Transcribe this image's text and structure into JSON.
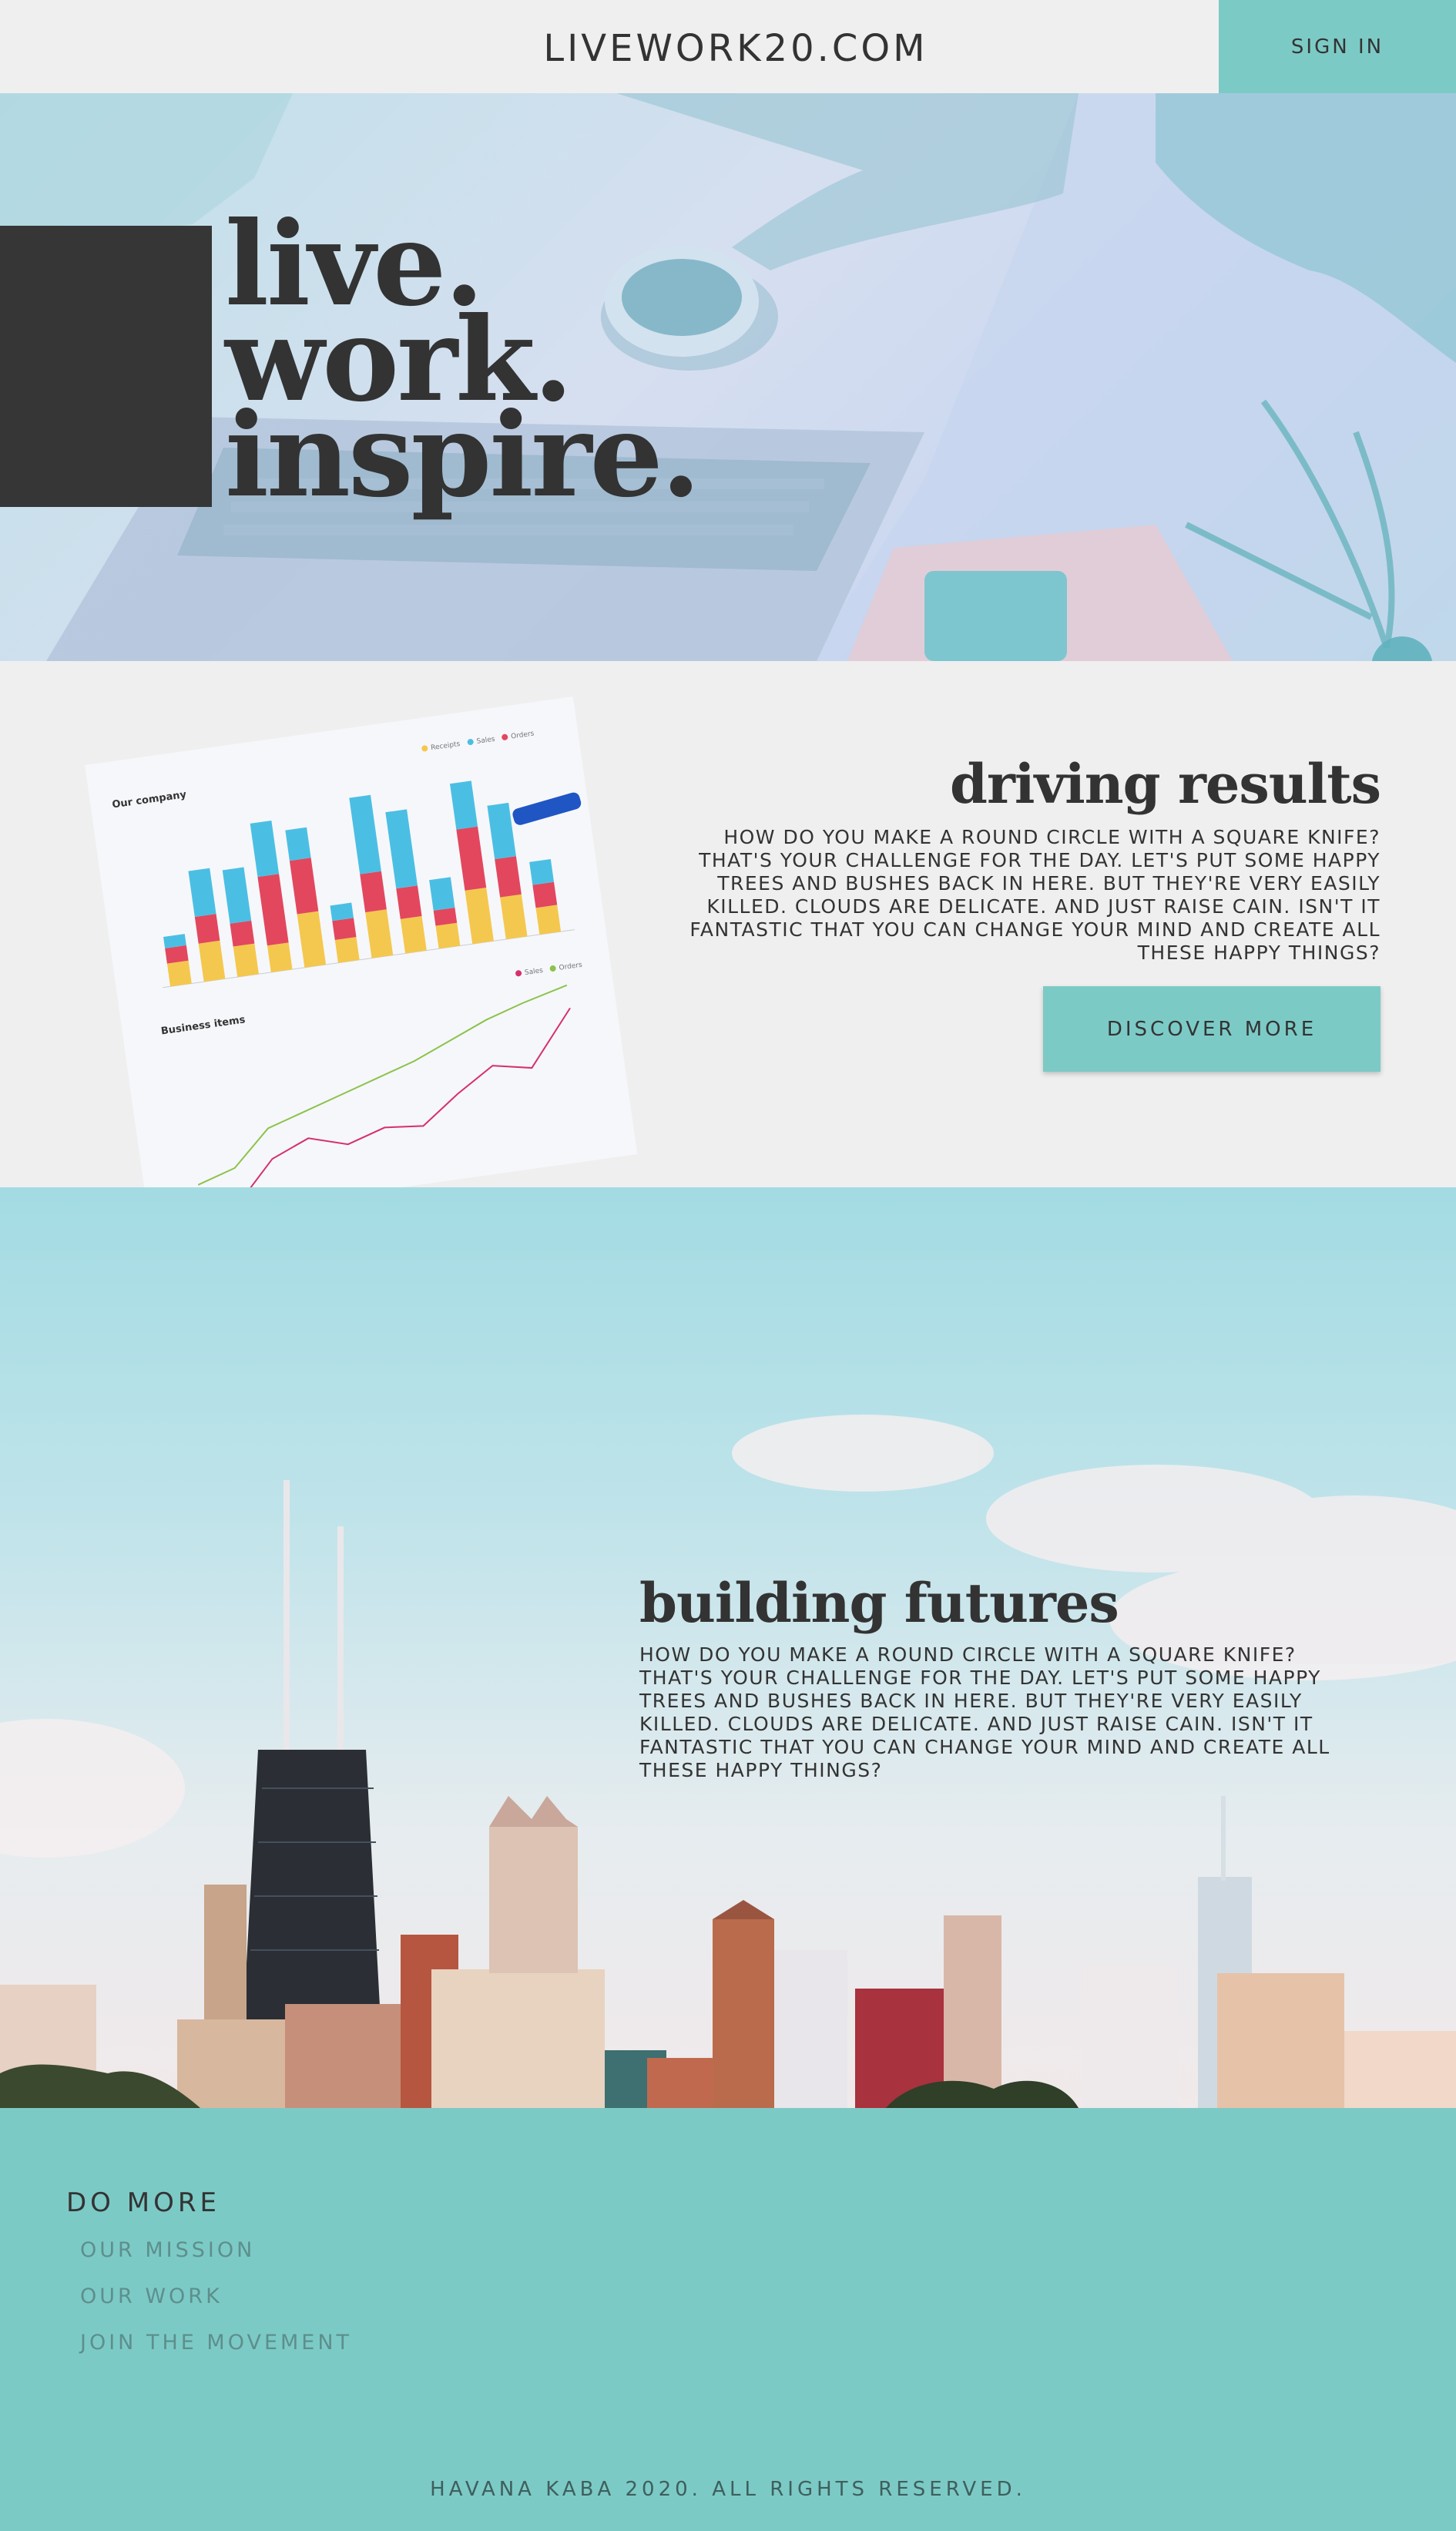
{
  "header": {
    "brand": "LIVEWORK20.COM",
    "signin_label": "SIGN IN"
  },
  "hero": {
    "line1": "live.",
    "line2": "work.",
    "line3": "inspire."
  },
  "results": {
    "title": "driving results",
    "body": "HOW DO YOU MAKE A ROUND CIRCLE WITH A SQUARE KNIFE? THAT'S YOUR CHALLENGE FOR THE DAY. LET'S PUT SOME HAPPY TREES AND BUSHES BACK IN HERE. BUT THEY'RE VERY EASILY KILLED. CLOUDS ARE DELICATE. AND JUST RAISE CAIN. ISN'T IT FANTASTIC THAT YOU CAN CHANGE YOUR MIND AND CREATE ALL THESE HAPPY THINGS?",
    "button_label": "DISCOVER MORE",
    "report": {
      "chart1_title": "Our company",
      "chart2_title": "Business items",
      "legend1": [
        "Receipts",
        "Sales",
        "Orders"
      ],
      "legend2": [
        "Sales",
        "Orders"
      ]
    }
  },
  "futures": {
    "title": "building futures",
    "body": "HOW DO YOU MAKE A ROUND CIRCLE WITH A SQUARE KNIFE? THAT'S YOUR CHALLENGE FOR THE DAY. LET'S PUT SOME HAPPY TREES AND BUSHES BACK IN HERE. BUT THEY'RE VERY EASILY KILLED. CLOUDS ARE DELICATE. AND JUST RAISE CAIN. ISN'T IT FANTASTIC THAT YOU CAN CHANGE YOUR MIND AND CREATE ALL THESE HAPPY THINGS?"
  },
  "footer": {
    "heading": "DO MORE",
    "links": [
      "OUR MISSION",
      "OUR WORK",
      "JOIN THE MOVEMENT"
    ],
    "copyright": "HAVANA KABA 2020. ALL RIGHTS RESERVED."
  },
  "colors": {
    "accent": "#7ccac6",
    "dark": "#333333",
    "background": "#efefef"
  }
}
